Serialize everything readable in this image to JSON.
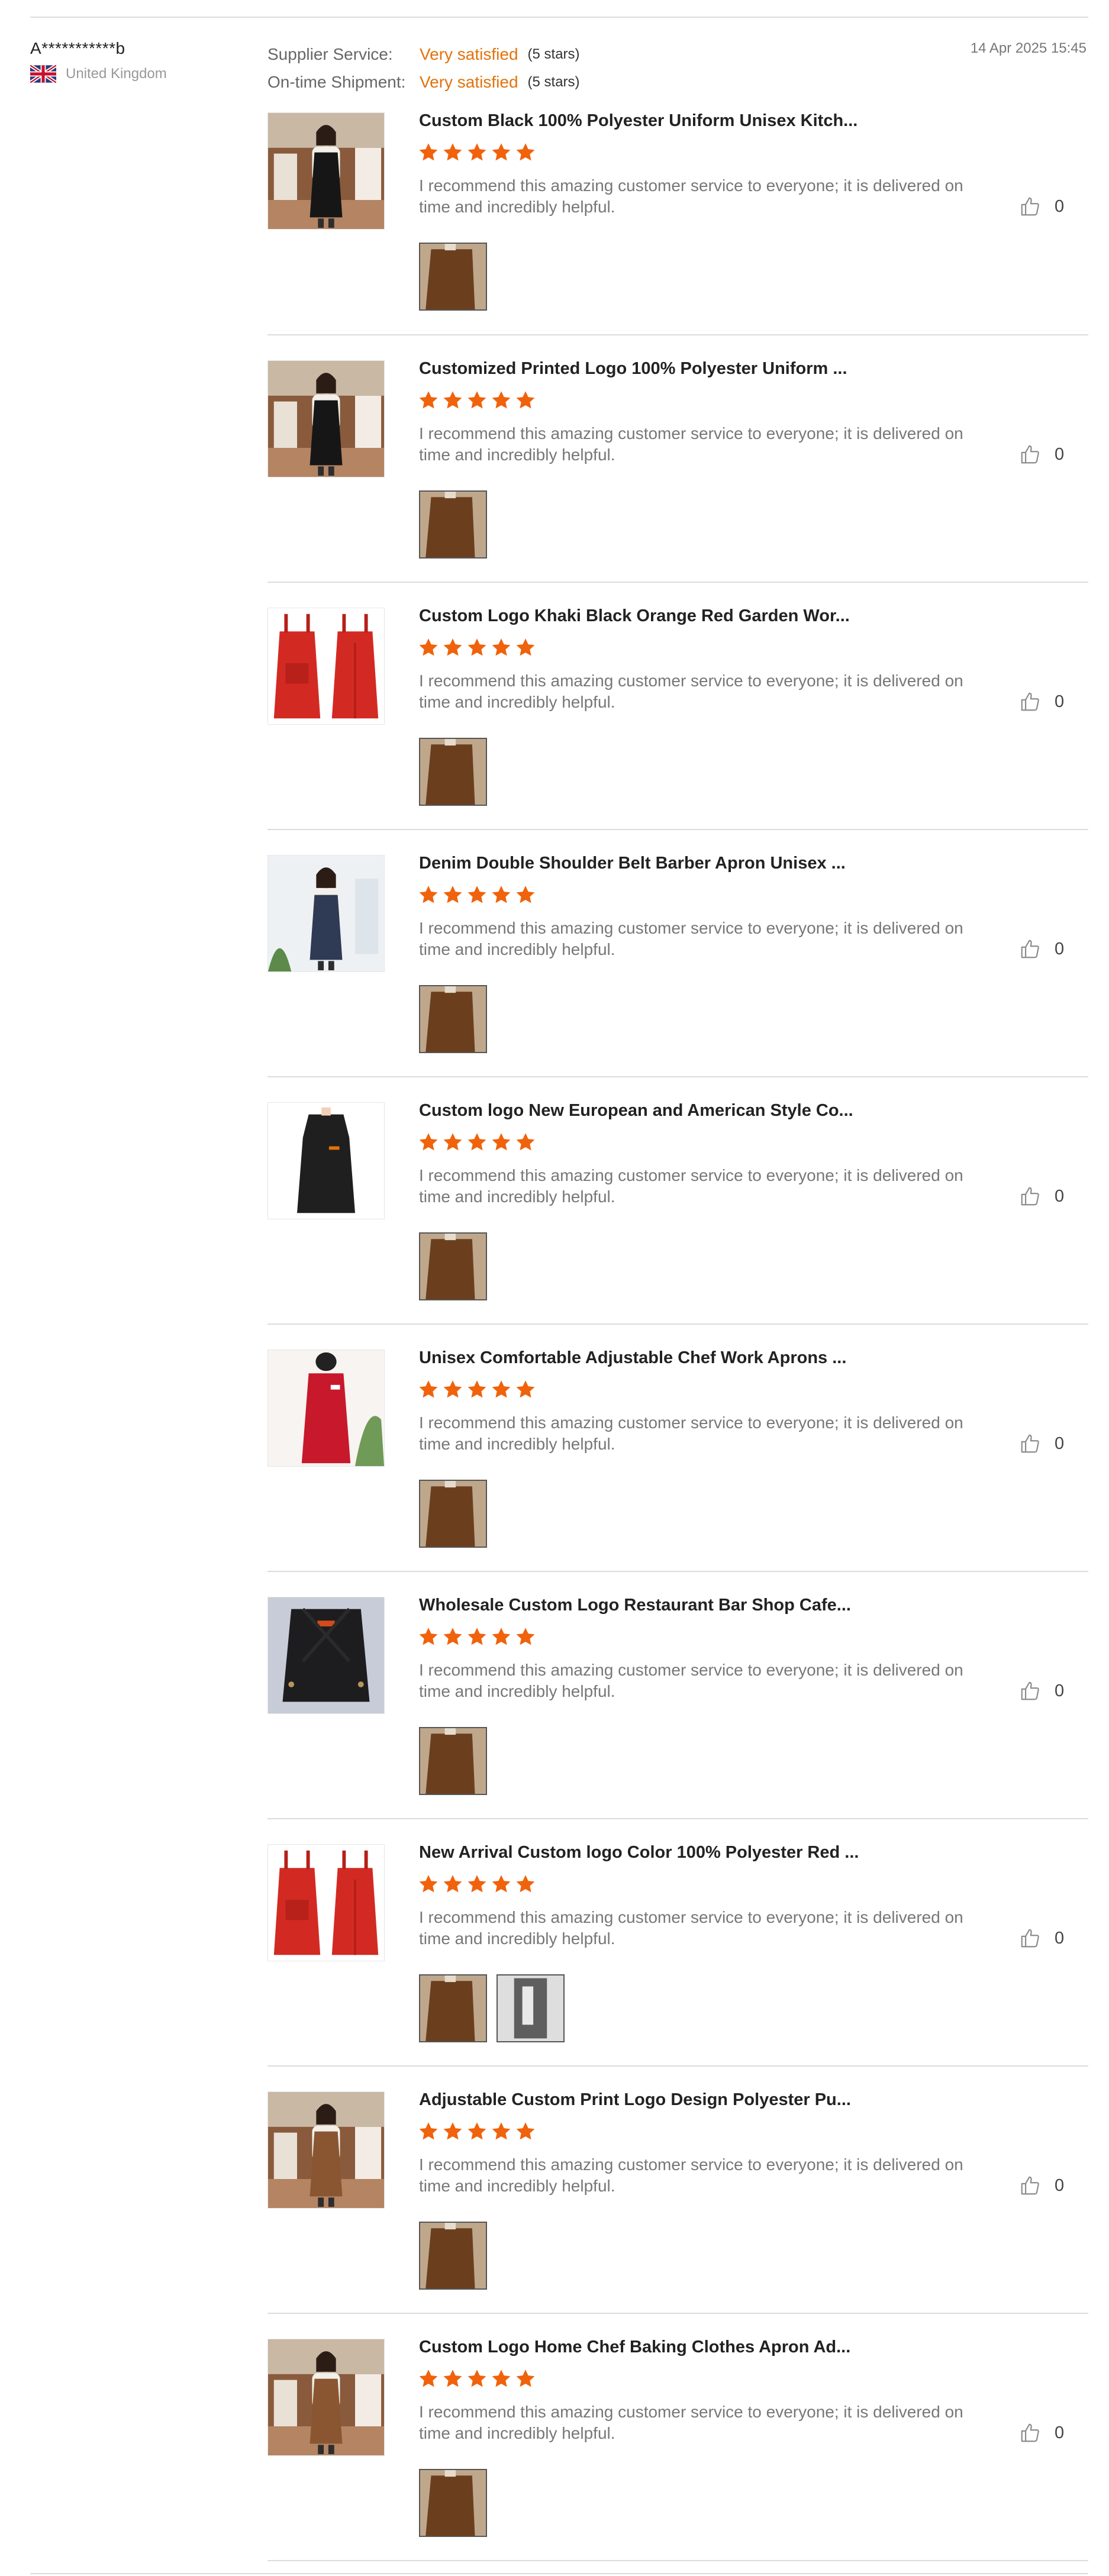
{
  "reviewer": {
    "name": "A***********b",
    "country": "United Kingdom",
    "flag_icon": "uk-flag-icon"
  },
  "ratings": [
    {
      "label": "Supplier Service:",
      "value": "Very satisfied",
      "stars": "(5 stars)"
    },
    {
      "label": "On-time Shipment:",
      "value": "Very satisfied",
      "stars": "(5 stars)"
    }
  ],
  "date": "14 Apr 2025 15:45",
  "colors": {
    "accent": "#e2720b",
    "star": "#f0620b",
    "divider": "#dcdcdc"
  },
  "review_text": "I recommend this amazing customer service to everyone; it is delivered on time and incredibly helpful.",
  "items": [
    {
      "title": "Custom Black 100% Polyester Uniform Unisex Kitch...",
      "rating": 5,
      "likes": "0",
      "thumb": "woman-black-apron",
      "photos": 1
    },
    {
      "title": "Customized Printed Logo 100% Polyester Uniform ...",
      "rating": 5,
      "likes": "0",
      "thumb": "woman-black-apron",
      "photos": 1
    },
    {
      "title": "Custom Logo Khaki Black Orange Red Garden Wor...",
      "rating": 5,
      "likes": "0",
      "thumb": "red-aprons",
      "photos": 1
    },
    {
      "title": "Denim Double Shoulder Belt Barber Apron Unisex ...",
      "rating": 5,
      "likes": "0",
      "thumb": "woman-denim-apron",
      "photos": 1
    },
    {
      "title": "Custom logo New European and American Style Co...",
      "rating": 5,
      "likes": "0",
      "thumb": "black-apron",
      "photos": 1
    },
    {
      "title": "Unisex Comfortable Adjustable Chef Work Aprons ...",
      "rating": 5,
      "likes": "0",
      "thumb": "red-apron-mannequin",
      "photos": 1
    },
    {
      "title": "Wholesale Custom Logo Restaurant Bar Shop Cafe...",
      "rating": 5,
      "likes": "0",
      "thumb": "black-cross-apron",
      "photos": 1
    },
    {
      "title": "New Arrival Custom logo Color 100% Polyester Red ...",
      "rating": 5,
      "likes": "0",
      "thumb": "red-aprons",
      "photos": 2
    },
    {
      "title": "Adjustable Custom Print Logo Design Polyester Pu...",
      "rating": 5,
      "likes": "0",
      "thumb": "woman-brown-apron",
      "photos": 1
    },
    {
      "title": "Custom Logo Home Chef Baking Clothes Apron Ad...",
      "rating": 5,
      "likes": "0",
      "thumb": "woman-brown-apron",
      "photos": 1
    }
  ]
}
